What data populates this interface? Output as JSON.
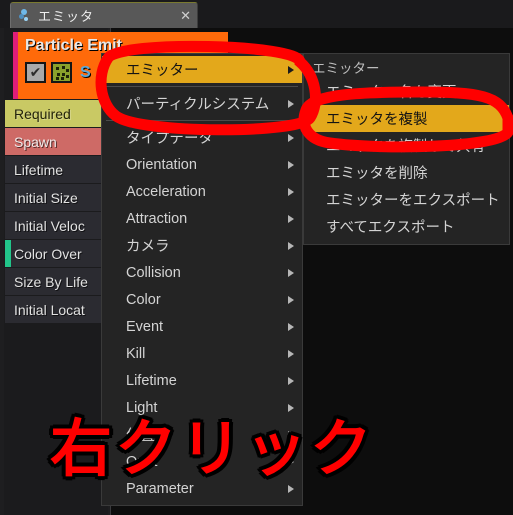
{
  "window": {
    "tab": {
      "label": "エミッタ",
      "icon": "particle-icon",
      "close": "✕"
    }
  },
  "emitter_header": {
    "title": "Particle Emit",
    "accent_color": "#e01e78",
    "background_color": "#ff6a0a",
    "enabled_checkbox": "✔",
    "solo_label": "S",
    "icons": [
      "enabled-checkbox-icon",
      "thumbnail-icon",
      "solo-icon"
    ]
  },
  "modules": [
    {
      "label": "Required",
      "style": "required",
      "strip": ""
    },
    {
      "label": "Spawn",
      "style": "spawn",
      "strip": ""
    },
    {
      "label": "Lifetime",
      "style": "normal",
      "strip": ""
    },
    {
      "label": "Initial Size",
      "style": "normal",
      "strip": ""
    },
    {
      "label": "Initial Veloc",
      "style": "normal",
      "strip": ""
    },
    {
      "label": "Color Over",
      "style": "normal",
      "strip": "#22c58a"
    },
    {
      "label": "Size By Life",
      "style": "normal",
      "strip": ""
    },
    {
      "label": "Initial Locat",
      "style": "normal",
      "strip": ""
    }
  ],
  "context_menu": {
    "items": [
      {
        "label": "エミッター",
        "arrow": true,
        "highlighted": true,
        "sep_after": true
      },
      {
        "label": "パーティクルシステム",
        "arrow": true,
        "highlighted": false,
        "sep_after": true
      },
      {
        "label": "タイプデータ",
        "arrow": true,
        "highlighted": false,
        "sep_after": false
      },
      {
        "label": "Orientation",
        "arrow": true,
        "highlighted": false,
        "sep_after": false
      },
      {
        "label": "Acceleration",
        "arrow": true,
        "highlighted": false,
        "sep_after": false
      },
      {
        "label": "Attraction",
        "arrow": true,
        "highlighted": false,
        "sep_after": false
      },
      {
        "label": "カメラ",
        "arrow": true,
        "highlighted": false,
        "sep_after": false
      },
      {
        "label": "Collision",
        "arrow": true,
        "highlighted": false,
        "sep_after": false
      },
      {
        "label": "Color",
        "arrow": true,
        "highlighted": false,
        "sep_after": false
      },
      {
        "label": "Event",
        "arrow": true,
        "highlighted": false,
        "sep_after": false
      },
      {
        "label": "Kill",
        "arrow": true,
        "highlighted": false,
        "sep_after": false
      },
      {
        "label": "Lifetime",
        "arrow": true,
        "highlighted": false,
        "sep_after": false
      },
      {
        "label": "Light",
        "arrow": true,
        "highlighted": false,
        "sep_after": false
      },
      {
        "label": "位置",
        "arrow": true,
        "highlighted": false,
        "sep_after": false
      },
      {
        "label": "Orbit",
        "arrow": true,
        "highlighted": false,
        "sep_after": false
      },
      {
        "label": "Parameter",
        "arrow": true,
        "highlighted": false,
        "sep_after": false
      }
    ]
  },
  "submenu": {
    "header": "エミッター",
    "items": [
      {
        "label": "エミッター名を変更",
        "highlighted": false
      },
      {
        "label": "エミッタを複製",
        "highlighted": true
      },
      {
        "label": "エミッタを複製して共有",
        "highlighted": false
      },
      {
        "label": "エミッタを削除",
        "highlighted": false
      },
      {
        "label": "エミッターをエクスポート",
        "highlighted": false
      },
      {
        "label": "すべてエクスポート",
        "highlighted": false
      }
    ]
  },
  "annotation": {
    "big_text": "右クリック",
    "color": "#ff0000",
    "outline_color": "#000000",
    "circles": [
      "emitter-menu-circle",
      "duplicate-emitter-circle"
    ]
  }
}
